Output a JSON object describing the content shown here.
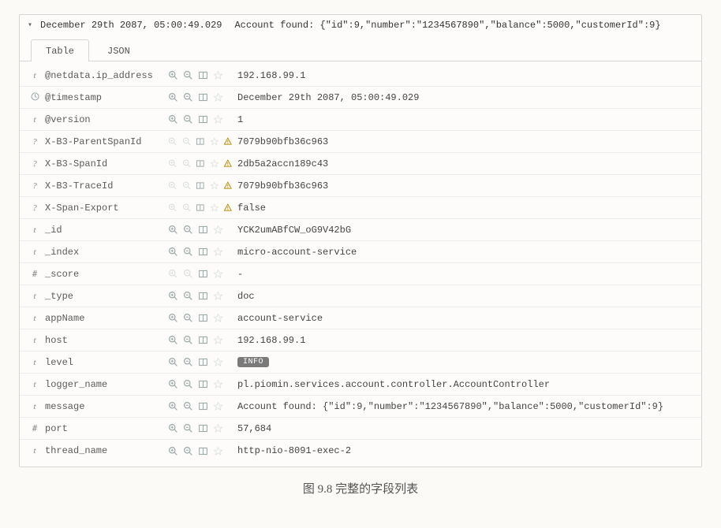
{
  "expand_timestamp": "December 29th 2087, 05:00:49.029",
  "expand_message": "Account found: {\"id\":9,\"number\":\"1234567890\",\"balance\":5000,\"customerId\":9}",
  "tabs": {
    "table": "Table",
    "json": "JSON"
  },
  "caption": "图 9.8   完整的字段列表",
  "fields": [
    {
      "type": "t",
      "name": "@netdata.ip_address",
      "value": "192.168.99.1",
      "zoom": true,
      "warn": false
    },
    {
      "type": "clk",
      "name": "@timestamp",
      "value": "December 29th 2087, 05:00:49.029",
      "zoom": true,
      "warn": false
    },
    {
      "type": "t",
      "name": "@version",
      "value": "1",
      "zoom": true,
      "warn": false
    },
    {
      "type": "?",
      "name": "X-B3-ParentSpanId",
      "value": "7079b90bfb36c963",
      "zoom": false,
      "warn": true
    },
    {
      "type": "?",
      "name": "X-B3-SpanId",
      "value": "2db5a2accn189c43",
      "zoom": false,
      "warn": true
    },
    {
      "type": "?",
      "name": "X-B3-TraceId",
      "value": "7079b90bfb36c963",
      "zoom": false,
      "warn": true
    },
    {
      "type": "?",
      "name": "X-Span-Export",
      "value": "false",
      "zoom": false,
      "warn": true
    },
    {
      "type": "t",
      "name": "_id",
      "value": "YCK2umABfCW_oG9V42bG",
      "zoom": true,
      "warn": false
    },
    {
      "type": "t",
      "name": "_index",
      "value": "micro-account-service",
      "zoom": true,
      "warn": false
    },
    {
      "type": "#",
      "name": "_score",
      "value": "-",
      "zoom": false,
      "warn": false
    },
    {
      "type": "t",
      "name": "_type",
      "value": "doc",
      "zoom": true,
      "warn": false
    },
    {
      "type": "t",
      "name": "appName",
      "value": "account-service",
      "zoom": true,
      "warn": false
    },
    {
      "type": "t",
      "name": "host",
      "value": "192.168.99.1",
      "zoom": true,
      "warn": false
    },
    {
      "type": "t",
      "name": "level",
      "value": "INFO",
      "zoom": true,
      "warn": false,
      "pill": true
    },
    {
      "type": "t",
      "name": "logger_name",
      "value": "pl.piomin.services.account.controller.AccountController",
      "zoom": true,
      "warn": false
    },
    {
      "type": "t",
      "name": "message",
      "value": "Account found: {\"id\":9,\"number\":\"1234567890\",\"balance\":5000,\"customerId\":9}",
      "zoom": true,
      "warn": false
    },
    {
      "type": "#",
      "name": "port",
      "value": "57,684",
      "zoom": true,
      "warn": false
    },
    {
      "type": "t",
      "name": "thread_name",
      "value": "http-nio-8091-exec-2",
      "zoom": true,
      "warn": false
    }
  ]
}
